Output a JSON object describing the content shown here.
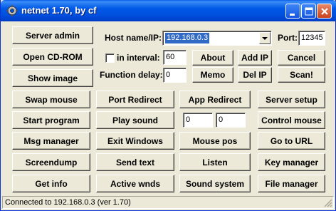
{
  "window": {
    "title": "netnet 1.70, by cf",
    "icon": "gear-icon"
  },
  "left_buttons": [
    "Server admin",
    "Open CD-ROM",
    "Show image"
  ],
  "host": {
    "label": "Host name/IP:",
    "value": "192.168.0.3",
    "port_label": "Port:",
    "port_value": "12345"
  },
  "interval": {
    "label": "in interval:",
    "checked": false,
    "value": "60"
  },
  "function_delay": {
    "label": "Function delay:",
    "value": "0"
  },
  "action_buttons": {
    "about": "About",
    "add_ip": "Add IP",
    "cancel": "Cancel",
    "memo": "Memo",
    "del_ip": "Del IP",
    "scan": "Scan!"
  },
  "grid": {
    "row1": [
      "Swap mouse",
      "Port Redirect",
      "App Redirect",
      "Server setup"
    ],
    "row2": [
      "Start program",
      "Play sound",
      "Control mouse"
    ],
    "row2_fields": [
      "0",
      "0"
    ],
    "row3": [
      "Msg manager",
      "Exit Windows",
      "Mouse pos",
      "Go to URL"
    ],
    "row4": [
      "Screendump",
      "Send text",
      "Listen",
      "Key manager"
    ],
    "row5": [
      "Get info",
      "Active wnds",
      "Sound system",
      "File manager"
    ]
  },
  "status": {
    "text": "Connected to 192.168.0.3 (ver 1.70)"
  }
}
